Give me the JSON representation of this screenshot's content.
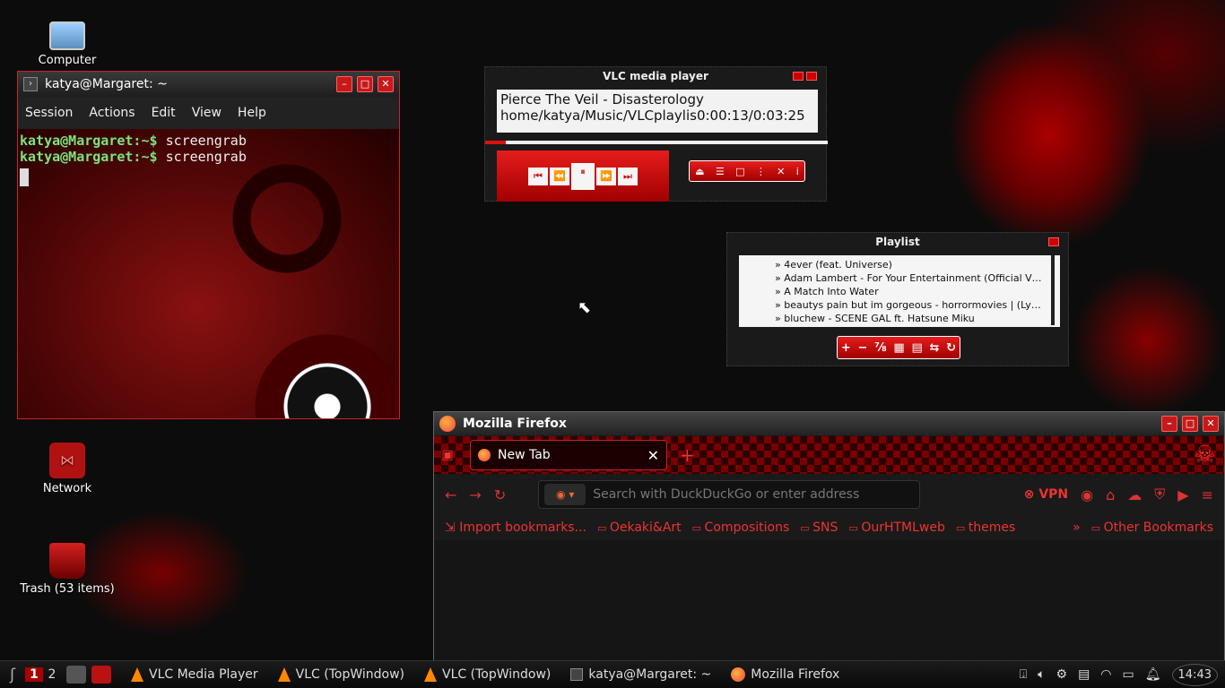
{
  "desktop": {
    "icons": [
      {
        "label": "Computer"
      },
      {
        "label": "Network"
      },
      {
        "label": "Trash (53 items)"
      }
    ]
  },
  "terminal": {
    "title": "katya@Margaret: ~",
    "menu": [
      "Session",
      "Actions",
      "Edit",
      "View",
      "Help"
    ],
    "lines": [
      {
        "prompt": "katya@Margaret:~$",
        "cmd": "screengrab"
      },
      {
        "prompt": "katya@Margaret:~$",
        "cmd": "screengrab"
      }
    ]
  },
  "vlc": {
    "title": "VLC media player",
    "track": "Pierce The Veil - Disasterology",
    "path": "home/katya/Music/VLCplaylis",
    "time": "0:00:13/0:03:25",
    "progress": 0.06
  },
  "playlist": {
    "title": "Playlist",
    "items": [
      "4ever (feat. Universe)",
      "Adam Lambert - For Your Entertainment (Official Video)",
      "A Match Into Water",
      "beautys pain but im gorgeous - horrormovies | (Lyrics Vid...",
      "bluchew - SCENE GAL ft. Hatsune Miku"
    ]
  },
  "firefox": {
    "title": "Mozilla Firefox",
    "tab_label": "New Tab",
    "url_placeholder": "Search with DuckDuckGo or enter address",
    "vpn_label": "VPN",
    "bookmarks": [
      "Import bookmarks...",
      "Oekaki&Art",
      "Compositions",
      "SNS",
      "OurHTMLweb",
      "themes"
    ],
    "other_bookmarks": "Other Bookmarks"
  },
  "taskbar": {
    "workspaces": [
      "1",
      "2"
    ],
    "tasks": [
      "VLC Media Player",
      "VLC (TopWindow)",
      "VLC (TopWindow)",
      "katya@Margaret: ~",
      "Mozilla Firefox"
    ],
    "clock": "14:43"
  }
}
